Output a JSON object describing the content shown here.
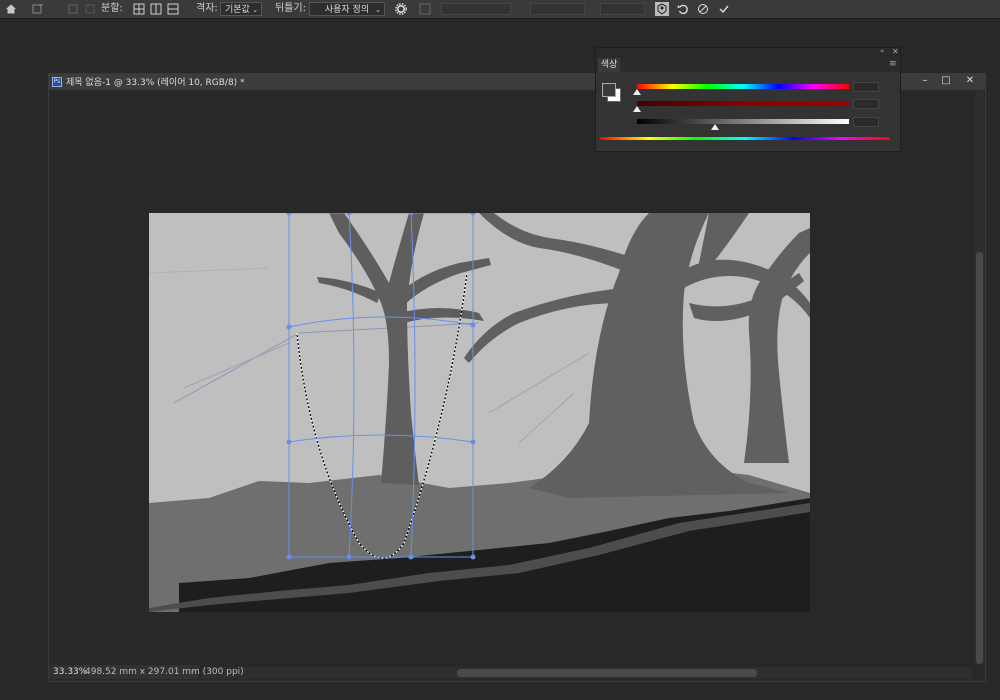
{
  "options_bar": {
    "distribute_label": "분할:",
    "grid_label": "격자:",
    "grid_value": "기본값",
    "warp_label": "뒤틀기:",
    "warp_value": "사용자 정의"
  },
  "document": {
    "title": "제목 없음-1 @ 33.3% (레이어 10, RGB/8) *",
    "icon_letter": "Ps",
    "minimize": "–",
    "restore": "□",
    "close": "✕"
  },
  "status": {
    "zoom": "33.33%",
    "doc_size": "498.52 mm x 297.01 mm (300 ppi)",
    "arrow": "›"
  },
  "color_panel": {
    "tab_label": "색상",
    "r_value": "",
    "g_value": "",
    "b_value": "",
    "r_thumb_fraction": 0.0,
    "g_thumb_fraction": 0.0,
    "b_thumb_fraction": 0.37,
    "bar_colors": {
      "bar1": "#ff0000",
      "bar2": "#8b0000",
      "bar3": "#ffffff"
    }
  },
  "colors": {
    "sky": "#bfbfbf",
    "trees": "#606060",
    "ground": "#1e1e1e",
    "mid_ground": "#6f6f6f",
    "mesh": "#6a8ee8"
  }
}
